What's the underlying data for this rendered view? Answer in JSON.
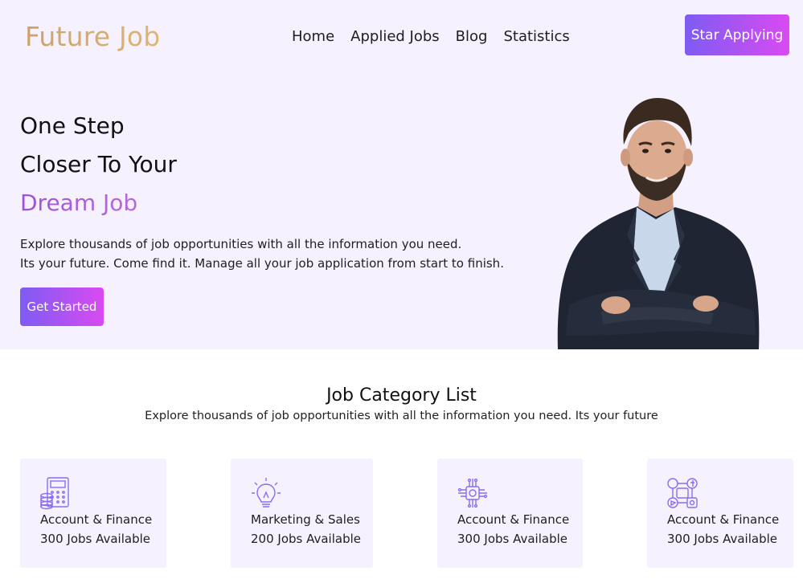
{
  "header": {
    "brand": "Future Job",
    "nav": [
      "Home",
      "Applied Jobs",
      "Blog",
      "Statistics"
    ],
    "cta": "Star Applying"
  },
  "hero": {
    "line1": "One Step",
    "line2": "Closer To Your",
    "highlight": "Dream Job",
    "desc_line1": "Explore thousands of job opportunities with all the information you need.",
    "desc_line2": "Its your future. Come find it. Manage all your job application from start to finish.",
    "button": "Get Started"
  },
  "categories": {
    "title": "Job Category List",
    "subtitle": "Explore thousands of job opportunities with all the information you need. Its your future",
    "items": [
      {
        "name": "Account & Finance",
        "count": "300 Jobs Available",
        "icon": "calculator-icon"
      },
      {
        "name": "Marketing & Sales",
        "count": "200 Jobs Available",
        "icon": "lightbulb-icon"
      },
      {
        "name": "Account & Finance",
        "count": "300 Jobs Available",
        "icon": "chip-icon"
      },
      {
        "name": "Account & Finance",
        "count": "300 Jobs Available",
        "icon": "social-media-icon"
      }
    ]
  },
  "colors": {
    "brand_gradient": [
      "#c9a36b",
      "#e0b473"
    ],
    "accent_gradient": [
      "#7e5cf2",
      "#d94af2"
    ],
    "hero_background": "#f5f1ff",
    "icon_stroke": "#8a6cf0"
  }
}
